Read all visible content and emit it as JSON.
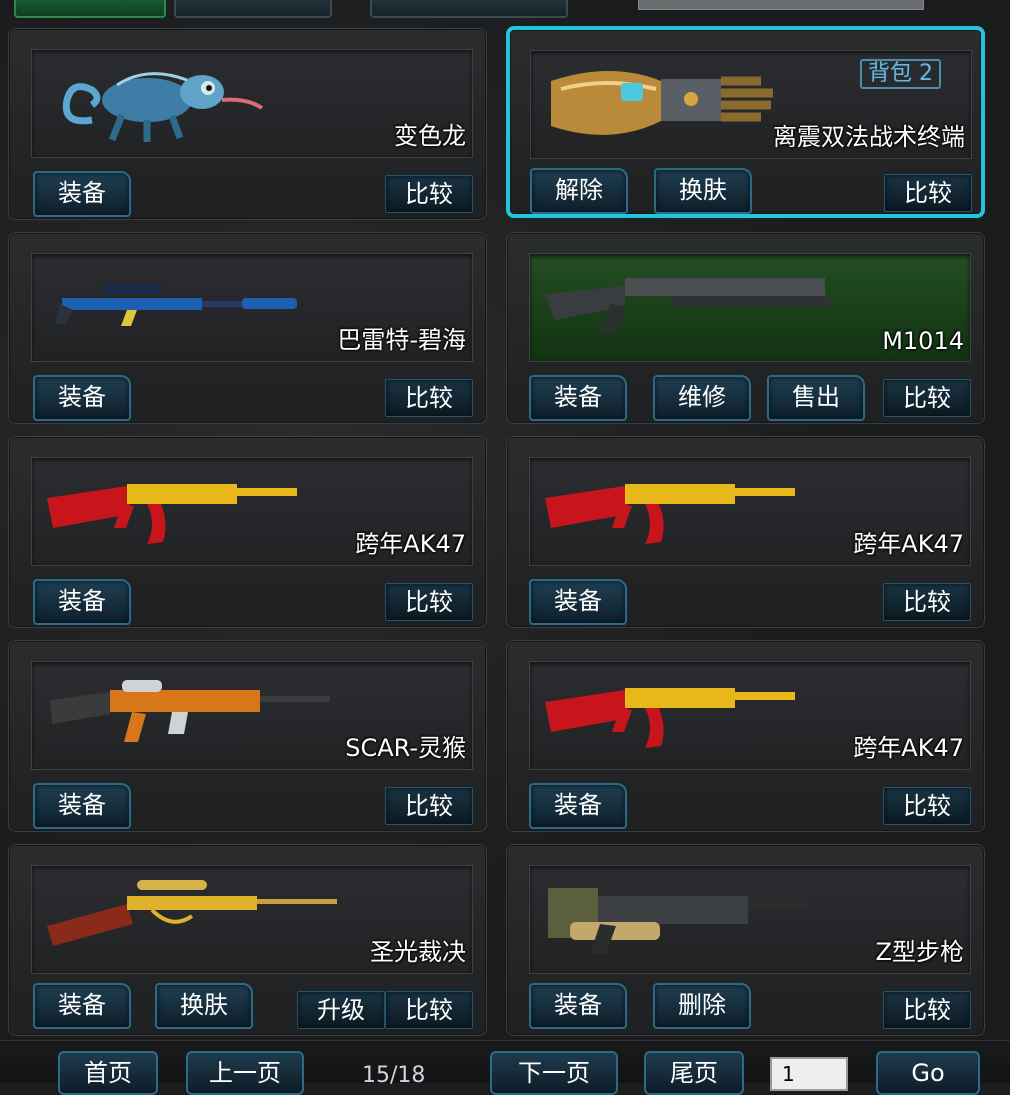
{
  "cards": [
    {
      "name": "变色龙",
      "buttons": [
        "装备"
      ],
      "compare": "比较",
      "icon": "chameleon-icon"
    },
    {
      "name": "离震双法战术终端",
      "badge": "背包 2",
      "buttons": [
        "解除",
        "换肤"
      ],
      "compare": "比较",
      "icon": "tactical-gauntlet-icon"
    },
    {
      "name": "巴雷特-碧海",
      "buttons": [
        "装备"
      ],
      "compare": "比较",
      "icon": "sniper-rifle-icon"
    },
    {
      "name": "M1014",
      "buttons": [
        "装备",
        "维修",
        "售出"
      ],
      "compare": "比较",
      "icon": "shotgun-icon"
    },
    {
      "name": "跨年AK47",
      "buttons": [
        "装备"
      ],
      "compare": "比较",
      "icon": "ak47-icon"
    },
    {
      "name": "跨年AK47",
      "buttons": [
        "装备"
      ],
      "compare": "比较",
      "icon": "ak47-icon"
    },
    {
      "name": "SCAR-灵猴",
      "buttons": [
        "装备"
      ],
      "compare": "比较",
      "icon": "scar-rifle-icon"
    },
    {
      "name": "跨年AK47",
      "buttons": [
        "装备"
      ],
      "compare": "比较",
      "icon": "ak47-icon"
    },
    {
      "name": "圣光裁决",
      "buttons": [
        "装备",
        "换肤"
      ],
      "extra": "升级",
      "compare": "比较",
      "icon": "golden-sniper-icon"
    },
    {
      "name": "Z型步枪",
      "buttons": [
        "装备",
        "删除"
      ],
      "compare": "比较",
      "icon": "z-rifle-icon"
    }
  ],
  "pager": {
    "first": "首页",
    "prev": "上一页",
    "info": "15/18",
    "next": "下一页",
    "last": "尾页",
    "page_value": "1",
    "go": "Go"
  },
  "colors": {
    "selected_border": "#1fc6dc",
    "button_border": "#2d6a86",
    "ak_red": "#c8141b",
    "gold": "#e8b71a"
  }
}
